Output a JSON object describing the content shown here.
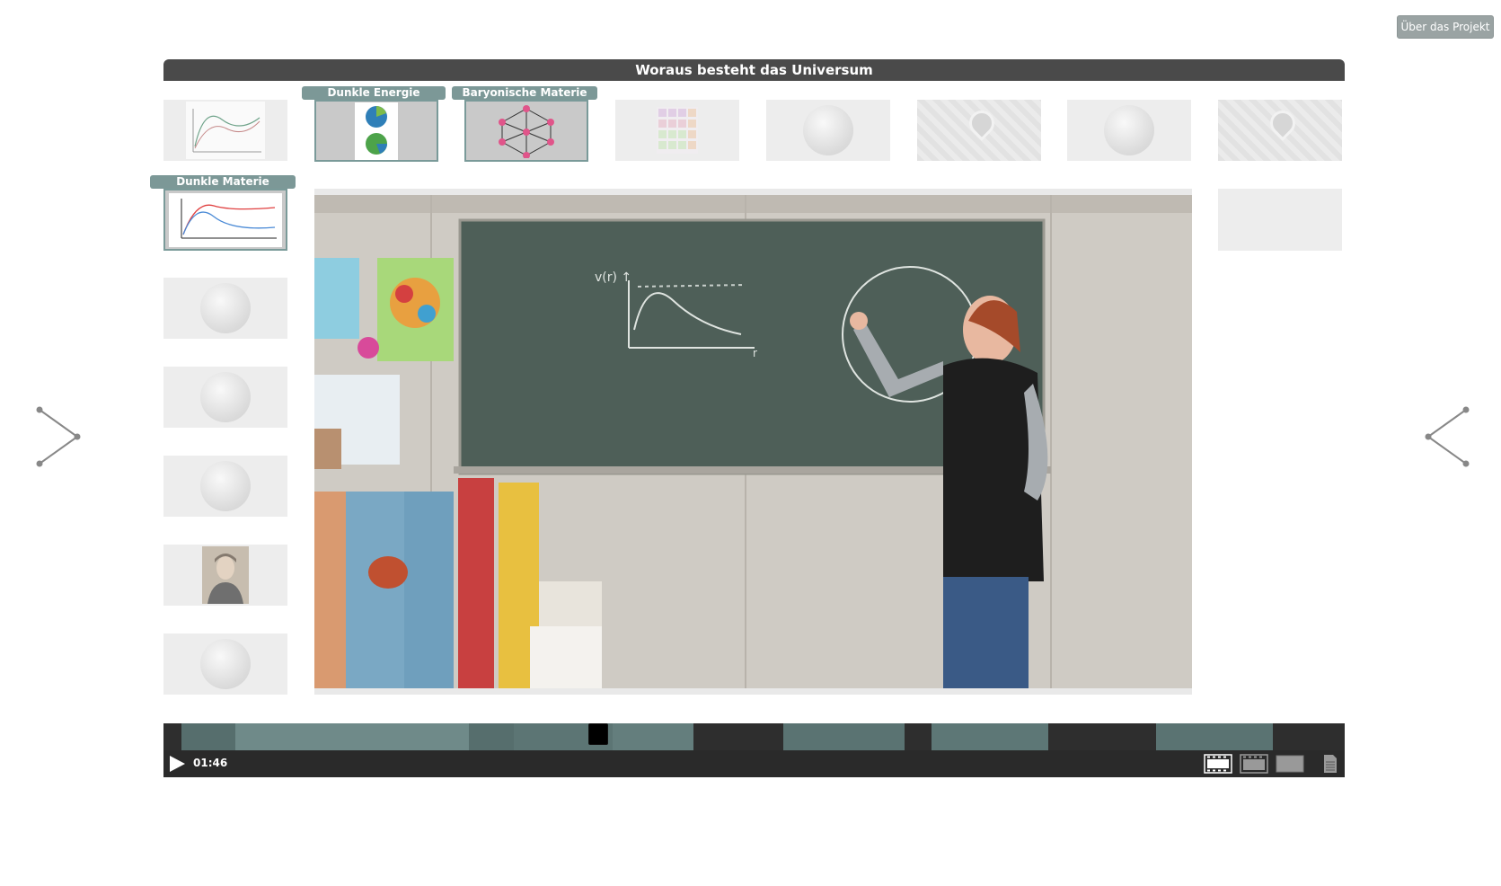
{
  "header": {
    "about_label": "Über das Projekt",
    "title": "Woraus besteht das Universum"
  },
  "tabs": {
    "dunkle_energie": "Dunkle Energie",
    "baryonische_materie": "Baryonische Materie",
    "dunkle_materie": "Dunkle Materie"
  },
  "player": {
    "time": "01:46",
    "progress_fraction": 0.36
  },
  "icons": {
    "prev": "chevron-right-arrow-icon",
    "next": "chevron-left-arrow-icon",
    "play": "play-icon",
    "view_filmstrip": "filmstrip-view-icon",
    "view_film": "film-view-icon",
    "view_single": "single-view-icon",
    "transcript": "document-icon"
  },
  "colors": {
    "accent": "#7c9897",
    "bar": "#4a4a4a",
    "timeline": "#2e2e2e"
  }
}
